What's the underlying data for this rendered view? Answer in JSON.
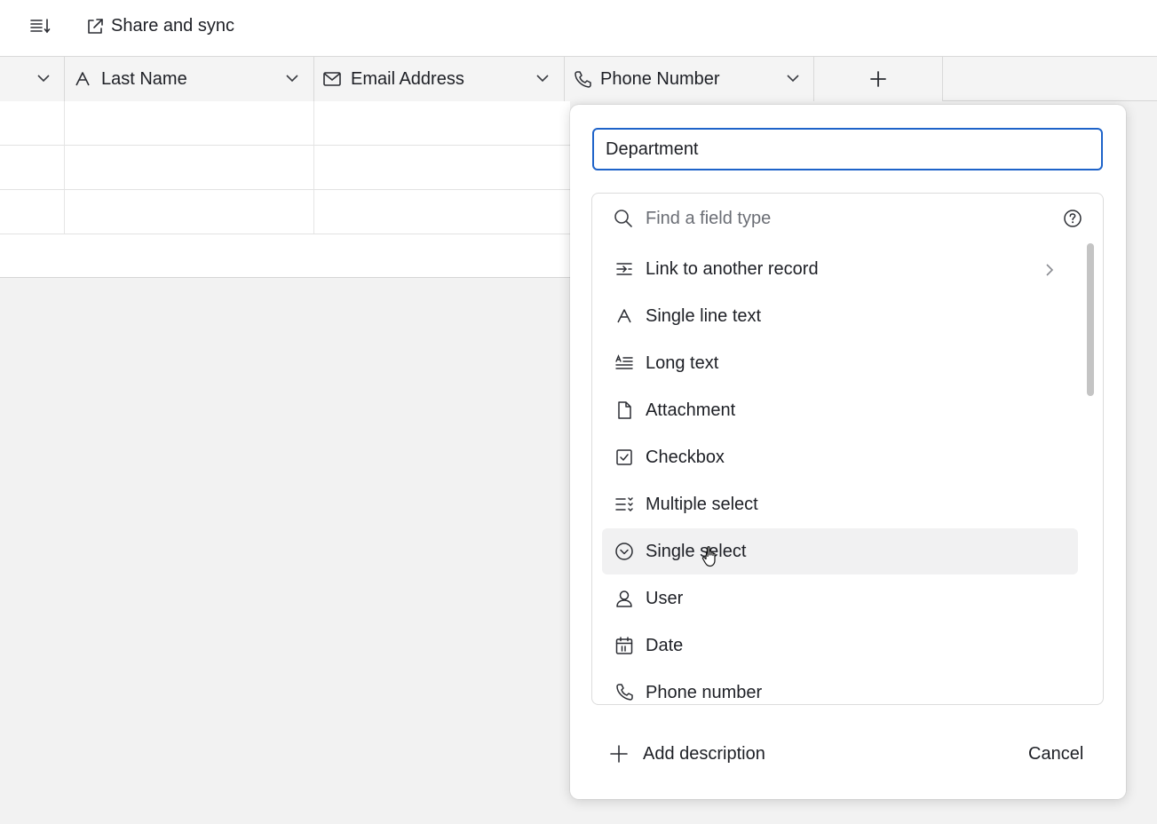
{
  "toolbar": {
    "menu_icon": "list-sort-icon",
    "share_icon": "external-link-icon",
    "share_label": "Share and sync"
  },
  "grid": {
    "columns": [
      {
        "label": "",
        "icon": "chevron-down-icon"
      },
      {
        "label": "Last Name",
        "icon": "text-a-icon"
      },
      {
        "label": "Email Address",
        "icon": "envelope-icon"
      },
      {
        "label": "Phone Number",
        "icon": "phone-icon"
      }
    ],
    "add_column_icon": "plus-icon"
  },
  "dialog": {
    "field_name_value": "Department",
    "search_placeholder": "Find a field type",
    "help_icon": "question-circle-icon",
    "field_types": [
      {
        "label": "Link to another record",
        "icon": "link-record-icon",
        "has_submenu": true
      },
      {
        "label": "Single line text",
        "icon": "text-a-icon"
      },
      {
        "label": "Long text",
        "icon": "long-text-icon"
      },
      {
        "label": "Attachment",
        "icon": "file-icon"
      },
      {
        "label": "Checkbox",
        "icon": "checkbox-icon"
      },
      {
        "label": "Multiple select",
        "icon": "multi-select-icon"
      },
      {
        "label": "Single select",
        "icon": "chevron-circle-icon",
        "hovered": true
      },
      {
        "label": "User",
        "icon": "user-icon"
      },
      {
        "label": "Date",
        "icon": "calendar-icon"
      },
      {
        "label": "Phone number",
        "icon": "phone-icon"
      }
    ],
    "add_description_label": "Add description",
    "cancel_label": "Cancel"
  },
  "colors": {
    "accent": "#1e63c9",
    "hover_bg": "#f1f1f2",
    "page_bg": "#f2f2f2"
  }
}
